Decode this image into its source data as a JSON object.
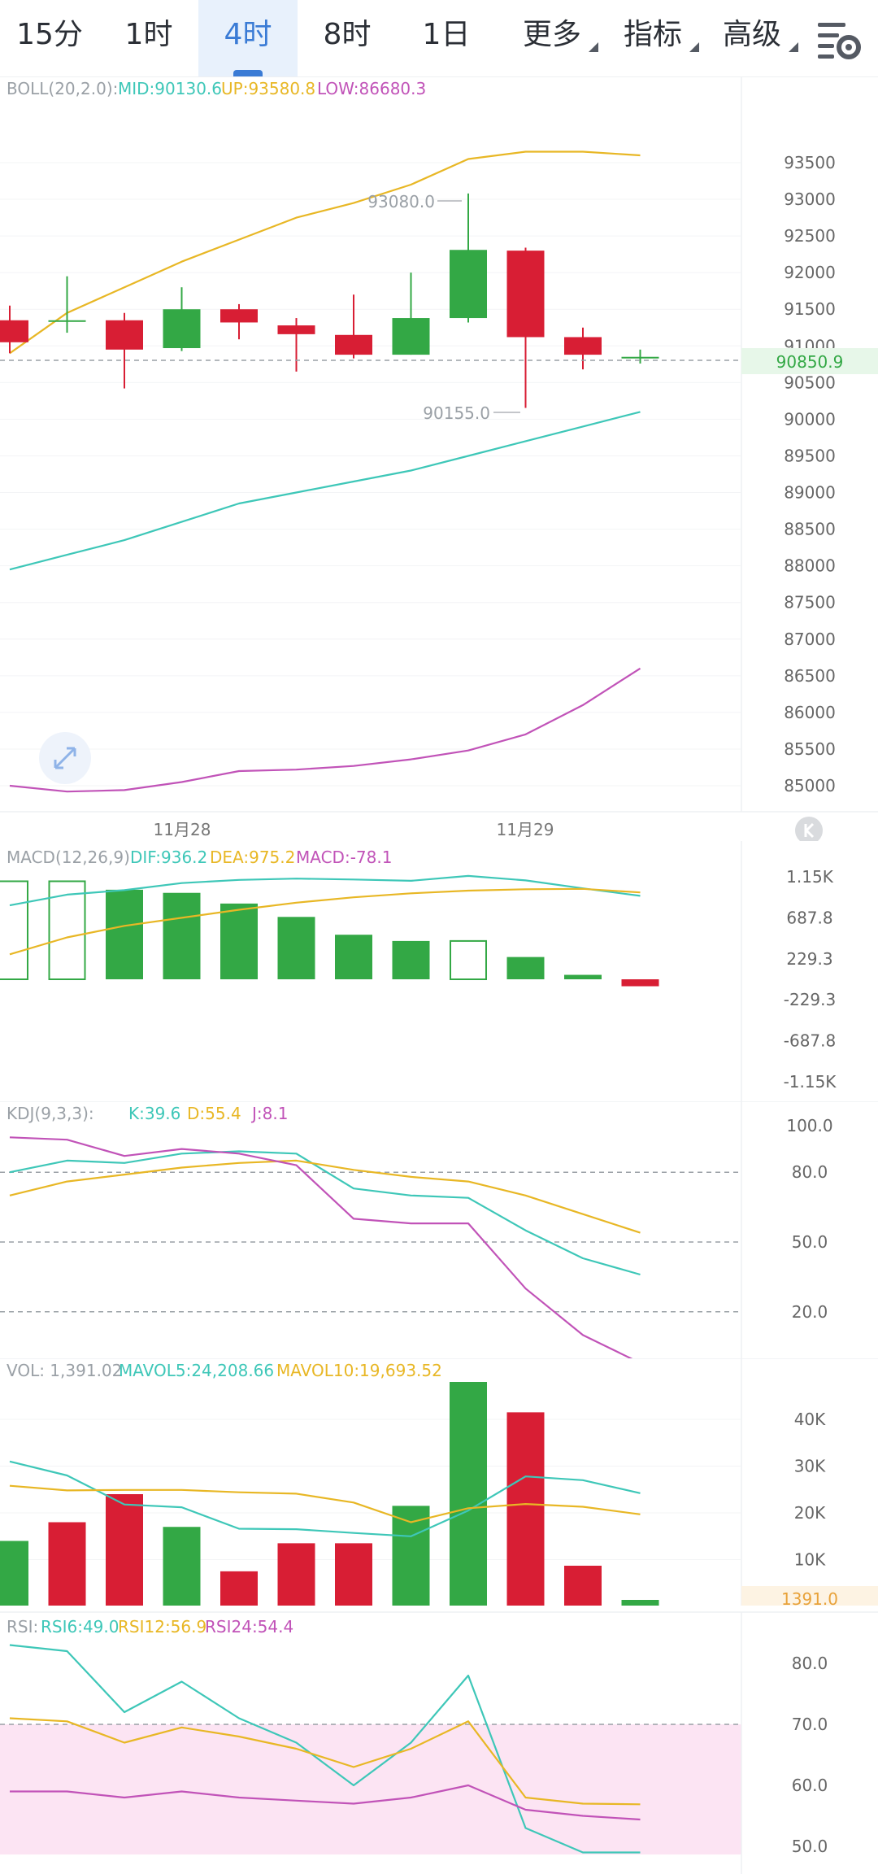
{
  "tabs": [
    {
      "label": "15分",
      "active": false
    },
    {
      "label": "1时",
      "active": false
    },
    {
      "label": "4时",
      "active": true
    },
    {
      "label": "8时",
      "active": false
    },
    {
      "label": "1日",
      "active": false
    }
  ],
  "dropdowns": [
    {
      "label": "更多"
    },
    {
      "label": "指标"
    },
    {
      "label": "高级"
    }
  ],
  "colors": {
    "up": "#33a845",
    "down": "#d81e34",
    "mid": "#3ec7b8",
    "upper": "#e8b725",
    "lower": "#c153b8",
    "axis_text": "#777777",
    "price_tag_bg": "#e7f7e9",
    "price_tag_text": "#33a845"
  },
  "boll": {
    "legend_name": "BOLL(20,2.0):",
    "mid_text": "MID:90130.6",
    "up_text": "UP:93580.8",
    "low_text": "LOW:86680.3",
    "y_ticks": [
      "93500",
      "93000",
      "92500",
      "92000",
      "91500",
      "91000",
      "90500",
      "90000",
      "89500",
      "89000",
      "88500",
      "88000",
      "87500",
      "87000",
      "86500",
      "86000",
      "85500",
      "85000"
    ],
    "current_price": "90850.9",
    "high_marker": "93080.0",
    "low_marker": "90155.0",
    "x_labels": [
      "11月28",
      "11月29"
    ]
  },
  "macd": {
    "legend_name": "MACD(12,26,9)",
    "dif_text": "DIF:936.2",
    "dea_text": "DEA:975.2",
    "macd_text": "MACD:-78.1",
    "y_ticks": [
      "1.15K",
      "687.8",
      "229.3",
      "-229.3",
      "-687.8",
      "-1.15K"
    ]
  },
  "kdj": {
    "legend_name": "KDJ(9,3,3):",
    "k_text": "K:39.6",
    "d_text": "D:55.4",
    "j_text": "J:8.1",
    "y_ticks": [
      "100.0",
      "80.0",
      "50.0",
      "20.0"
    ]
  },
  "vol": {
    "legend_name": "VOL: 1,391.02",
    "ma5_text": "MAVOL5:24,208.66",
    "ma10_text": "MAVOL10:19,693.52",
    "y_ticks": [
      "40K",
      "30K",
      "20K",
      "10K"
    ],
    "current": "1391.0"
  },
  "rsi": {
    "legend_name": "RSI:",
    "rsi6_text": "RSI6:49.0",
    "rsi12_text": "RSI12:56.9",
    "rsi24_text": "RSI24:54.4",
    "y_ticks": [
      "80.0",
      "70.0",
      "60.0",
      "50.0"
    ]
  },
  "chart_data": [
    {
      "type": "candlestick",
      "title": "BOLL(20,2.0)",
      "candles": [
        {
          "o": 91350,
          "c": 91050,
          "h": 91550,
          "l": 90900
        },
        {
          "o": 91350,
          "c": 91350,
          "h": 91950,
          "l": 91180
        },
        {
          "o": 91350,
          "c": 90950,
          "h": 91450,
          "l": 90420
        },
        {
          "o": 90970,
          "c": 91500,
          "h": 91800,
          "l": 90930
        },
        {
          "o": 91500,
          "c": 91320,
          "h": 91570,
          "l": 91090
        },
        {
          "o": 91280,
          "c": 91160,
          "h": 91380,
          "l": 90650
        },
        {
          "o": 91150,
          "c": 90880,
          "h": 91700,
          "l": 90830
        },
        {
          "o": 90880,
          "c": 91380,
          "h": 92000,
          "l": 90880
        },
        {
          "o": 91380,
          "c": 92310,
          "h": 93080,
          "l": 91320
        },
        {
          "o": 92300,
          "c": 91120,
          "h": 92340,
          "l": 90155
        },
        {
          "o": 91120,
          "c": 90880,
          "h": 91250,
          "l": 90680
        },
        {
          "o": 90850,
          "c": 90851,
          "h": 90950,
          "l": 90760
        }
      ],
      "up_line": [
        90900,
        91450,
        91800,
        92150,
        92450,
        92750,
        92950,
        93200,
        93550,
        93650,
        93650,
        93600
      ],
      "mid_line": [
        87950,
        88150,
        88350,
        88600,
        88850,
        89000,
        89150,
        89300,
        89500,
        89700,
        89900,
        90100
      ],
      "low_line": [
        85000,
        84920,
        84940,
        85050,
        85200,
        85220,
        85270,
        85360,
        85480,
        85700,
        86100,
        86600
      ],
      "ylim": [
        84800,
        93800
      ],
      "x_labels": [
        "11月28",
        "11月29"
      ]
    },
    {
      "type": "bar",
      "title": "MACD(12,26,9)",
      "macd": [
        1100,
        1100,
        1005,
        970,
        850,
        700,
        500,
        430,
        430,
        250,
        50,
        -78
      ],
      "hollow": [
        true,
        true,
        false,
        false,
        false,
        false,
        false,
        false,
        true,
        false,
        false,
        false
      ],
      "dif": [
        830,
        950,
        1000,
        1080,
        1115,
        1130,
        1120,
        1105,
        1160,
        1110,
        1020,
        936
      ],
      "dea": [
        280,
        470,
        600,
        690,
        780,
        860,
        920,
        965,
        995,
        1010,
        1015,
        975
      ],
      "ylim": [
        -1300,
        1300
      ]
    },
    {
      "type": "line",
      "title": "KDJ(9,3,3)",
      "k": [
        80,
        85,
        84,
        88,
        89,
        88,
        73,
        70,
        69,
        55,
        43,
        36
      ],
      "d": [
        70,
        76,
        79,
        82,
        84,
        85,
        81,
        78,
        76,
        70,
        62,
        54
      ],
      "j": [
        95,
        94,
        87,
        90,
        88,
        83,
        60,
        58,
        58,
        30,
        10,
        -2
      ],
      "ylim": [
        -10,
        110
      ],
      "ref_lines": [
        80,
        50,
        20
      ]
    },
    {
      "type": "bar",
      "title": "VOL",
      "volumes": [
        14000,
        18000,
        24000,
        17000,
        7500,
        13500,
        13500,
        21500,
        48000,
        41500,
        8700,
        1391
      ],
      "up": [
        true,
        false,
        false,
        true,
        false,
        false,
        false,
        true,
        true,
        false,
        false,
        true
      ],
      "ma5": [
        31000,
        28000,
        21800,
        21200,
        16600,
        16500,
        15700,
        15000,
        20500,
        27800,
        27000,
        24208
      ],
      "ma10": [
        25800,
        24800,
        24900,
        24900,
        24400,
        24100,
        22200,
        18000,
        21000,
        21900,
        21300,
        19693
      ],
      "ylim": [
        0,
        49000
      ]
    },
    {
      "type": "line",
      "title": "RSI",
      "rsi6": [
        83,
        82,
        72,
        77,
        71,
        67,
        60,
        67,
        78,
        53,
        49,
        49
      ],
      "rsi12": [
        71,
        70.5,
        67,
        69.5,
        68,
        66,
        63,
        66,
        70.5,
        58,
        57,
        56.9
      ],
      "rsi24": [
        59,
        59,
        58,
        59,
        58,
        57.5,
        57,
        58,
        60,
        56,
        55,
        54.4
      ],
      "ylim": [
        48.5,
        84
      ],
      "band": [
        50,
        70
      ]
    }
  ]
}
